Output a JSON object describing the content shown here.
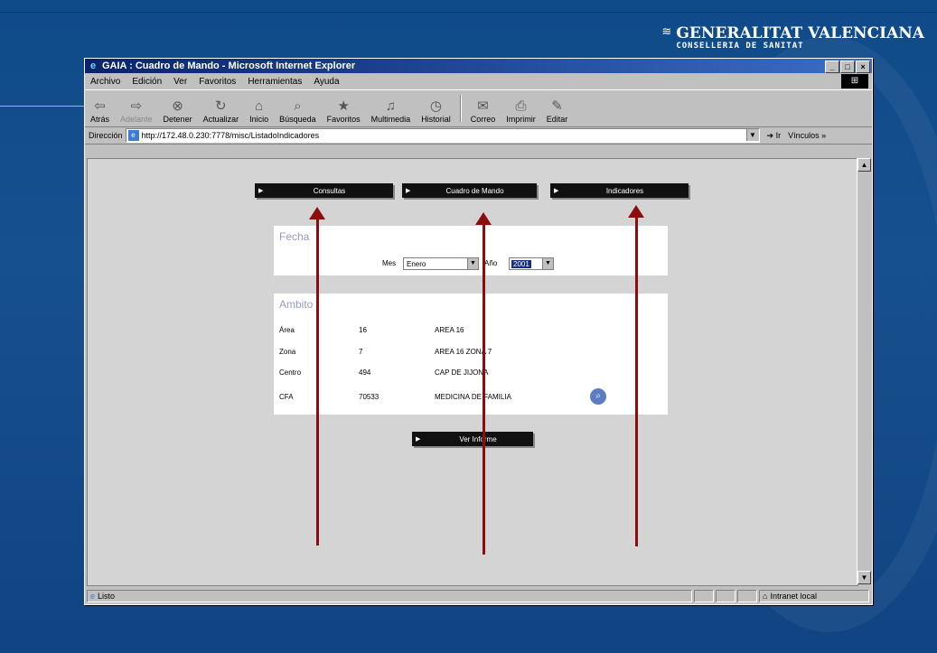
{
  "logo": {
    "line1": "GENERALITAT VALENCIANA",
    "line2": "CONSELLERIA DE SANITAT"
  },
  "window": {
    "title": "GAIA : Cuadro de Mando - Microsoft Internet Explorer",
    "controls": [
      "_",
      "□",
      "×"
    ]
  },
  "menu": [
    "Archivo",
    "Edición",
    "Ver",
    "Favoritos",
    "Herramientas",
    "Ayuda"
  ],
  "toolbar": [
    {
      "label": "Atrás",
      "icon": "back-icon",
      "glyph": "⇦",
      "disabled": false
    },
    {
      "label": "Adelante",
      "icon": "forward-icon",
      "glyph": "⇨",
      "disabled": true
    },
    {
      "label": "Detener",
      "icon": "stop-icon",
      "glyph": "⊗",
      "disabled": false
    },
    {
      "label": "Actualizar",
      "icon": "refresh-icon",
      "glyph": "↻",
      "disabled": false
    },
    {
      "label": "Inicio",
      "icon": "home-icon",
      "glyph": "⌂",
      "disabled": false
    },
    {
      "label": "Búsqueda",
      "icon": "search-icon",
      "glyph": "⌕",
      "disabled": false
    },
    {
      "label": "Favoritos",
      "icon": "favorites-icon",
      "glyph": "★",
      "disabled": false
    },
    {
      "label": "Multimedia",
      "icon": "media-icon",
      "glyph": "♫",
      "disabled": false
    },
    {
      "label": "Historial",
      "icon": "history-icon",
      "glyph": "◷",
      "disabled": false
    },
    {
      "label": "Correo",
      "icon": "mail-icon",
      "glyph": "✉",
      "disabled": false
    },
    {
      "label": "Imprimir",
      "icon": "print-icon",
      "glyph": "⎙",
      "disabled": false
    },
    {
      "label": "Editar",
      "icon": "edit-icon",
      "glyph": "✎",
      "disabled": false
    }
  ],
  "address": {
    "label": "Dirección",
    "url": "http://172.48.0.230:7778/misc/ListadoIndicadores",
    "go": "Ir",
    "links": "Vínculos »"
  },
  "nav": {
    "consultas": "Consultas",
    "cuadro": "Cuadro de Mando",
    "indicadores": "Indicadores"
  },
  "fecha": {
    "title": "Fecha",
    "mes_label": "Mes",
    "mes_value": "Enero",
    "anio_label": "Año",
    "anio_value": "2001"
  },
  "ambito": {
    "title": "Ambito",
    "rows": [
      {
        "label": "Área",
        "code": "16",
        "desc": "AREA 16"
      },
      {
        "label": "Zona",
        "code": "7",
        "desc": "AREA 16 ZONA 7"
      },
      {
        "label": "Centro",
        "code": "494",
        "desc": "CAP DE JIJONA"
      },
      {
        "label": "CFA",
        "code": "70533",
        "desc": "MEDICINA DE FAMILIA"
      }
    ]
  },
  "ver_informe": "Ver Informe",
  "status": {
    "left": "Listo",
    "zone": "Intranet local"
  }
}
